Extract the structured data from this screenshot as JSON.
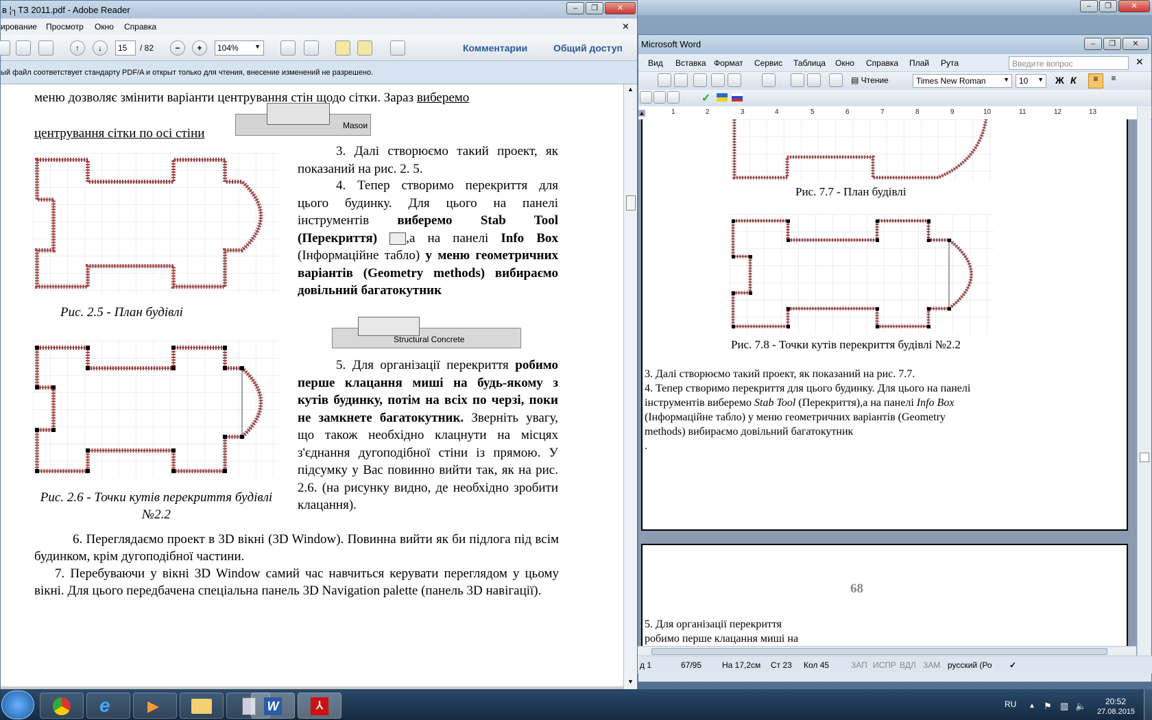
{
  "reader": {
    "title": "в ¦┐ТЗ 2011.pdf - Adobe Reader",
    "menu": [
      "ирование",
      "Просмотр",
      "Окно",
      "Справка"
    ],
    "page_current": "15",
    "page_total": "/ 82",
    "zoom": "104%",
    "comments_label": "Комментарии",
    "share_label": "Общий доступ",
    "notice": "ый файл соответствует стандарту PDF/A и открыт только для чтения, внесение изменений не разрешено.",
    "doc": {
      "line1": "меню дозволяє змінити варіанти центрування стін щодо сітки. Зараз",
      "line1_u": "виберемо",
      "line2_u": "центрування сітки по осі стіни",
      "masonry": "Masoи",
      "p3": "3. Далі створюємо такий проект, як показаний на рис. 2. 5.",
      "p4a": "4. Тепер створимо перекриття для цього будинку. Для цього на панелі інструментів",
      "p4b": "виберемо Stab Tool (Перекриття)",
      "p4c": ",а на панелі",
      "p4d": "Info Box",
      "p4e": "(Інформаційне табло)",
      "p4f": "у меню геометричних варіантів (Geometry methods) вибираємо довільний багатокутник",
      "fig25": "Рис. 2.5 - План будівлі",
      "structural": "Structural Concrete",
      "p5a": "5. Для організації перекриття",
      "p5b": "робимо перше клацання миші на будь-якому з кутів будинку, потім на всіх по черзі, поки не замкнете багатокутник.",
      "p5c": "Зверніть увагу, що також необхідно клацнути на місцях з'єднання дугоподібної стіни із прямою. У підсумку у Вас повинно вийти так, як на рис. 2.6. (на рисунку видно, де необхідно зробити клацання).",
      "fig26": "Рис. 2.6 - Точки кутів перекриття будівлі №2.2",
      "p6": "6. Переглядаємо проект в 3D вікні (3D Window). Повинна вийти як би підлога під всім будинком, крім дугоподібної частини.",
      "p7": "7. Перебуваючи у вікні 3D Window самий час навчиться керувати переглядом у цьому вікні. Для цього передбачена спеціальна панель 3D Navigation palette (панель 3D навігації)."
    }
  },
  "word": {
    "title": "Microsoft Word",
    "menu": [
      "Вид",
      "Вставка",
      "Формат",
      "Сервис",
      "Таблица",
      "Окно",
      "Справка",
      "Плай",
      "Рута"
    ],
    "question_placeholder": "Введите вопрос",
    "reading_label": "Чтение",
    "font": "Times New Roman",
    "size": "10",
    "bold_label": "Ж",
    "italic_label": "К",
    "ruler_marks": [
      "1",
      "2",
      "3",
      "4",
      "5",
      "6",
      "7",
      "8",
      "9",
      "10",
      "11",
      "12",
      "13"
    ],
    "fig77": "Рис. 7.7 - План будівлі",
    "fig78": "Рис. 7.8 - Точки кутів перекриття будівлі №2.2",
    "w1": "3. Далі створюємо такий проект, як показаний на рис. 7.7.",
    "w2": "4. Тепер створимо перекриття для цього будинку. Для цього на панелі",
    "w3a": "інструментів виберемо ",
    "w3b": "Stab Tool",
    "w3c": " (Перекриття),а на панелі ",
    "w3d": "Info Box",
    "w4": "(Інформаційне табло) у меню геометричних варіантів (Geometry",
    "w5": "methods) вибираємо довільний багатокутник",
    "w6": ".",
    "page_number": "68",
    "w7": "5. Для організації перекриття",
    "w8": "робимо перше клацання миші на",
    "status": {
      "page": "д 1",
      "pages": "67/95",
      "at": "На 17,2см",
      "line": "Ст 23",
      "col": "Кол 45",
      "rec": "ЗАП",
      "trk": "ИСПР",
      "ext": "ВДЛ",
      "ovr": "ЗАМ",
      "lang": "русский (Ро"
    }
  },
  "taskbar": {
    "lang": "RU",
    "time": "20:52",
    "date": "27.08.2015"
  },
  "colors": {
    "accent": "#2a5a9a",
    "hatch": "#c04040",
    "taskbar": "#1c3550"
  }
}
